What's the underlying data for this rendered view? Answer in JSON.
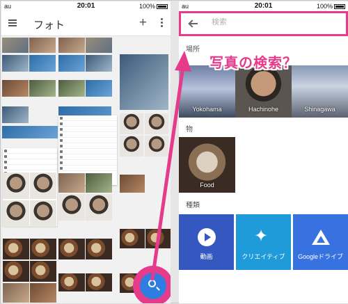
{
  "left_phone": {
    "status": {
      "carrier": "au",
      "time": "20:01",
      "battery": "100%"
    },
    "appbar": {
      "title": "フォト"
    }
  },
  "right_phone": {
    "status": {
      "carrier": "au",
      "time": "20:01",
      "battery": "100%"
    },
    "search": {
      "placeholder": "検索"
    },
    "sections": {
      "places": "場所",
      "things": "物",
      "types": "種類"
    },
    "places": [
      "Yokohama",
      "Hachinohe",
      "Shinagawa"
    ],
    "things": [
      "Food"
    ],
    "types": [
      "動画",
      "クリエイティブ",
      "Googleドライブ"
    ]
  },
  "annotation": {
    "text": "写真の検索？",
    "color": "#e63a8a"
  },
  "accent": {
    "highlight": "#e63a8a",
    "fab_blue": "#2f7de1"
  }
}
